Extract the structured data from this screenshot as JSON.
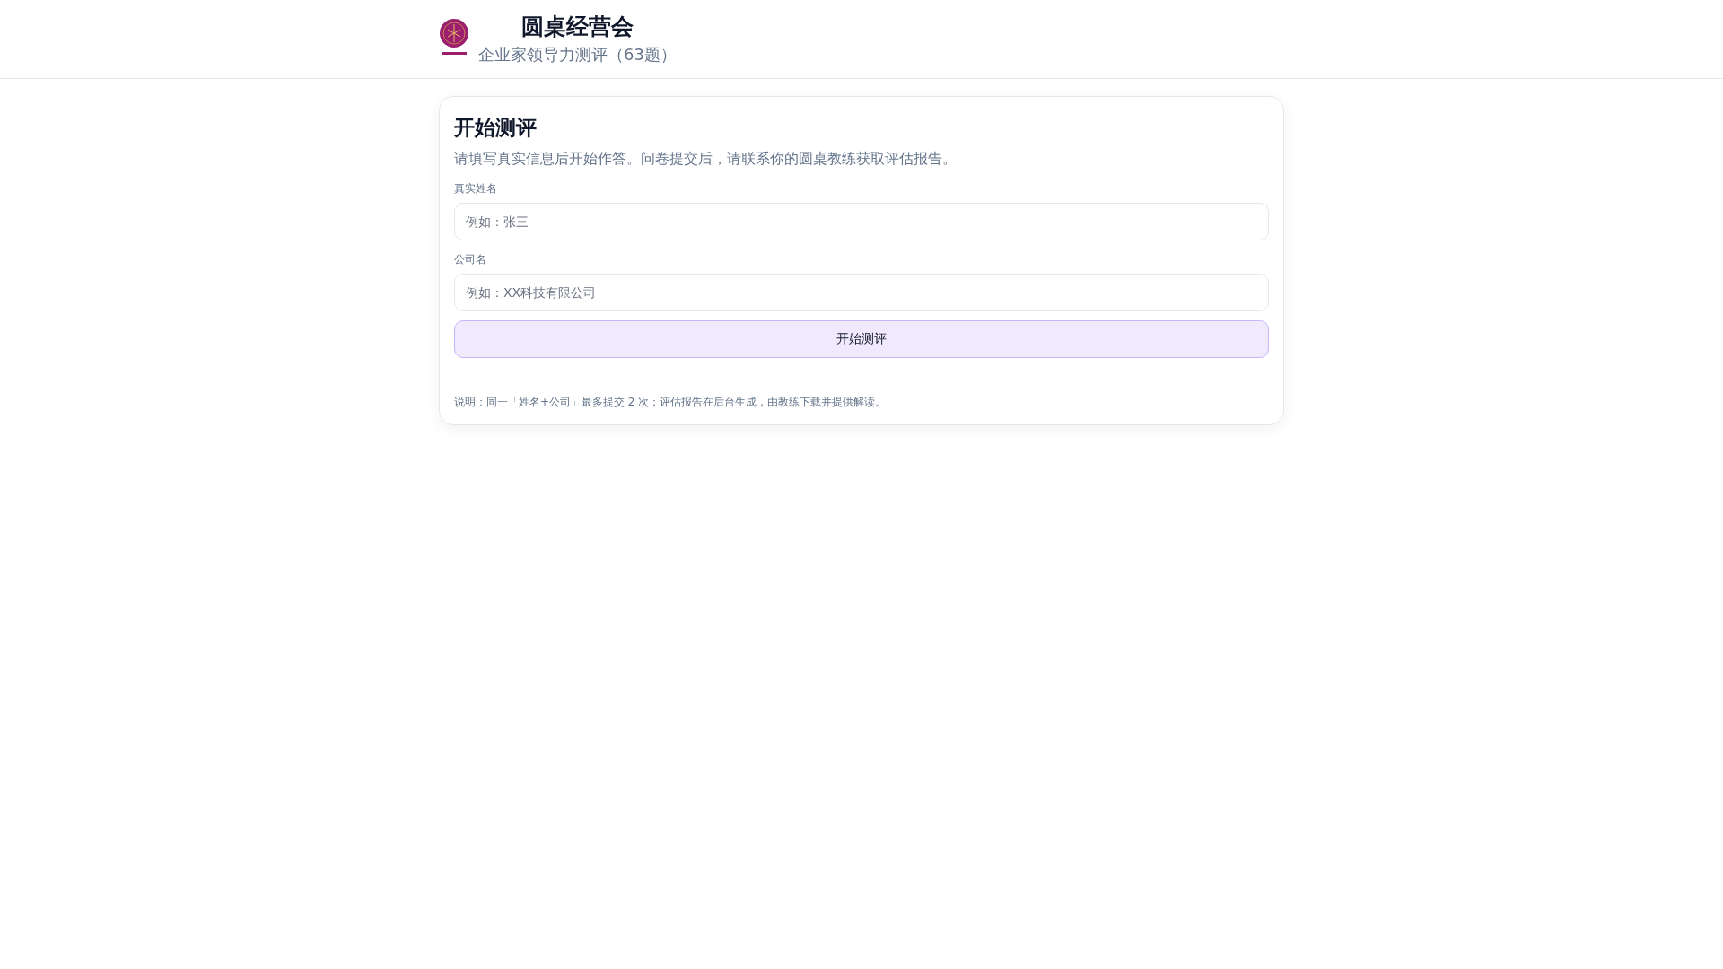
{
  "header": {
    "title": "圆桌经营会",
    "subtitle": "企业家领导力测评（63题）"
  },
  "card": {
    "title": "开始测评",
    "description": "请填写真实信息后开始作答。问卷提交后，请联系你的圆桌教练获取评估报告。",
    "fields": [
      {
        "label": "真实姓名",
        "placeholder": "例如：张三"
      },
      {
        "label": "公司名",
        "placeholder": "例如：XX科技有限公司"
      }
    ],
    "button": "开始测评",
    "note": "说明：同一「姓名+公司」最多提交 2 次；评估报告在后台生成，由教练下载并提供解读。"
  }
}
